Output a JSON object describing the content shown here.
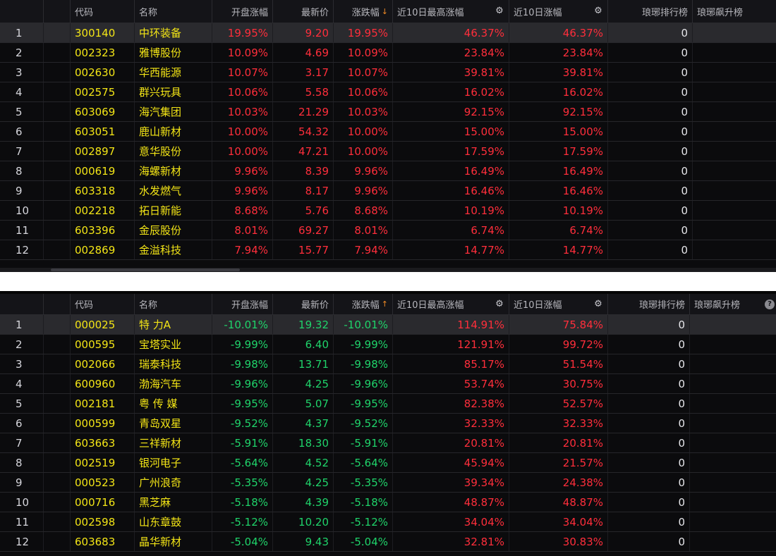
{
  "columns": {
    "code": "代码",
    "name": "名称",
    "open_change": "开盘涨幅",
    "latest_price": "最新价",
    "change": "涨跌幅",
    "ten_day_high": "近10日最高涨幅",
    "ten_day_change": "近10日涨幅",
    "rank_list": "琅琊排行榜",
    "rising_list": "琅琊飙升榜"
  },
  "icons": {
    "sort_desc": "down-arrow-icon",
    "sort_asc": "up-arrow-icon",
    "settings": "gear-icon",
    "help": "question-icon"
  },
  "colors": {
    "up": "#ff2e3b",
    "down": "#1fd36a",
    "code": "#f3e516",
    "sort_arrow": "#f08a24"
  },
  "top_table": {
    "sort_arrow": "↓",
    "rows": [
      {
        "idx": "1",
        "code": "300140",
        "name": "中环装备",
        "open": "19.95%",
        "price": "9.20",
        "chg": "19.95%",
        "hi10": "46.37%",
        "c10": "46.37%",
        "rank": "0"
      },
      {
        "idx": "2",
        "code": "002323",
        "name": "雅博股份",
        "open": "10.09%",
        "price": "4.69",
        "chg": "10.09%",
        "hi10": "23.84%",
        "c10": "23.84%",
        "rank": "0"
      },
      {
        "idx": "3",
        "code": "002630",
        "name": "华西能源",
        "open": "10.07%",
        "price": "3.17",
        "chg": "10.07%",
        "hi10": "39.81%",
        "c10": "39.81%",
        "rank": "0"
      },
      {
        "idx": "4",
        "code": "002575",
        "name": "群兴玩具",
        "open": "10.06%",
        "price": "5.58",
        "chg": "10.06%",
        "hi10": "16.02%",
        "c10": "16.02%",
        "rank": "0"
      },
      {
        "idx": "5",
        "code": "603069",
        "name": "海汽集团",
        "open": "10.03%",
        "price": "21.29",
        "chg": "10.03%",
        "hi10": "92.15%",
        "c10": "92.15%",
        "rank": "0"
      },
      {
        "idx": "6",
        "code": "603051",
        "name": "鹿山新材",
        "open": "10.00%",
        "price": "54.32",
        "chg": "10.00%",
        "hi10": "15.00%",
        "c10": "15.00%",
        "rank": "0"
      },
      {
        "idx": "7",
        "code": "002897",
        "name": "意华股份",
        "open": "10.00%",
        "price": "47.21",
        "chg": "10.00%",
        "hi10": "17.59%",
        "c10": "17.59%",
        "rank": "0"
      },
      {
        "idx": "8",
        "code": "000619",
        "name": "海螺新材",
        "open": "9.96%",
        "price": "8.39",
        "chg": "9.96%",
        "hi10": "16.49%",
        "c10": "16.49%",
        "rank": "0"
      },
      {
        "idx": "9",
        "code": "603318",
        "name": "水发燃气",
        "open": "9.96%",
        "price": "8.17",
        "chg": "9.96%",
        "hi10": "16.46%",
        "c10": "16.46%",
        "rank": "0"
      },
      {
        "idx": "10",
        "code": "002218",
        "name": "拓日新能",
        "open": "8.68%",
        "price": "5.76",
        "chg": "8.68%",
        "hi10": "10.19%",
        "c10": "10.19%",
        "rank": "0"
      },
      {
        "idx": "11",
        "code": "603396",
        "name": "金辰股份",
        "open": "8.01%",
        "price": "69.27",
        "chg": "8.01%",
        "hi10": "6.74%",
        "c10": "6.74%",
        "rank": "0"
      },
      {
        "idx": "12",
        "code": "002869",
        "name": "金溢科技",
        "open": "7.94%",
        "price": "15.77",
        "chg": "7.94%",
        "hi10": "14.77%",
        "c10": "14.77%",
        "rank": "0"
      }
    ]
  },
  "bottom_table": {
    "sort_arrow": "↑",
    "rows": [
      {
        "idx": "1",
        "code": "000025",
        "name": "特 力A",
        "open": "-10.01%",
        "price": "19.32",
        "chg": "-10.01%",
        "hi10": "114.91%",
        "c10": "75.84%",
        "rank": "0"
      },
      {
        "idx": "2",
        "code": "000595",
        "name": "宝塔实业",
        "open": "-9.99%",
        "price": "6.40",
        "chg": "-9.99%",
        "hi10": "121.91%",
        "c10": "99.72%",
        "rank": "0"
      },
      {
        "idx": "3",
        "code": "002066",
        "name": "瑞泰科技",
        "open": "-9.98%",
        "price": "13.71",
        "chg": "-9.98%",
        "hi10": "85.17%",
        "c10": "51.54%",
        "rank": "0"
      },
      {
        "idx": "4",
        "code": "600960",
        "name": "渤海汽车",
        "open": "-9.96%",
        "price": "4.25",
        "chg": "-9.96%",
        "hi10": "53.74%",
        "c10": "30.75%",
        "rank": "0"
      },
      {
        "idx": "5",
        "code": "002181",
        "name": "粤 传 媒",
        "open": "-9.95%",
        "price": "5.07",
        "chg": "-9.95%",
        "hi10": "82.38%",
        "c10": "52.57%",
        "rank": "0"
      },
      {
        "idx": "6",
        "code": "000599",
        "name": "青岛双星",
        "open": "-9.52%",
        "price": "4.37",
        "chg": "-9.52%",
        "hi10": "32.33%",
        "c10": "32.33%",
        "rank": "0"
      },
      {
        "idx": "7",
        "code": "603663",
        "name": "三祥新材",
        "open": "-5.91%",
        "price": "18.30",
        "chg": "-5.91%",
        "hi10": "20.81%",
        "c10": "20.81%",
        "rank": "0"
      },
      {
        "idx": "8",
        "code": "002519",
        "name": "银河电子",
        "open": "-5.64%",
        "price": "4.52",
        "chg": "-5.64%",
        "hi10": "45.94%",
        "c10": "21.57%",
        "rank": "0"
      },
      {
        "idx": "9",
        "code": "000523",
        "name": "广州浪奇",
        "open": "-5.35%",
        "price": "4.25",
        "chg": "-5.35%",
        "hi10": "39.34%",
        "c10": "24.38%",
        "rank": "0"
      },
      {
        "idx": "10",
        "code": "000716",
        "name": "黑芝麻",
        "open": "-5.18%",
        "price": "4.39",
        "chg": "-5.18%",
        "hi10": "48.87%",
        "c10": "48.87%",
        "rank": "0"
      },
      {
        "idx": "11",
        "code": "002598",
        "name": "山东章鼓",
        "open": "-5.12%",
        "price": "10.20",
        "chg": "-5.12%",
        "hi10": "34.04%",
        "c10": "34.04%",
        "rank": "0"
      },
      {
        "idx": "12",
        "code": "603683",
        "name": "晶华新材",
        "open": "-5.04%",
        "price": "9.43",
        "chg": "-5.04%",
        "hi10": "32.81%",
        "c10": "30.83%",
        "rank": "0"
      }
    ]
  }
}
